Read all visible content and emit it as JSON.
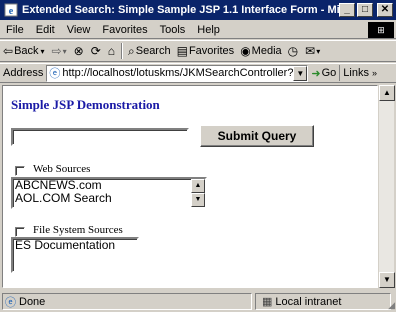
{
  "window": {
    "title": "Extended Search: Simple Sample JSP 1.1 Interface Form - Mi...",
    "min_glyph": "_",
    "max_glyph": "□",
    "close_glyph": "✕"
  },
  "menu": {
    "items": [
      "File",
      "Edit",
      "View",
      "Favorites",
      "Tools",
      "Help"
    ]
  },
  "toolbar": {
    "back_label": "Back",
    "search_label": "Search",
    "favorites_label": "Favorites",
    "media_label": "Media"
  },
  "address": {
    "label": "Address",
    "url": "http://localhost/lotuskms/JKMSearchController?desJ",
    "go_label": "Go",
    "links_label": "Links"
  },
  "page": {
    "heading": "Simple JSP Demonstration",
    "query_value": "",
    "submit_label": "Submit Query",
    "web_sources": {
      "label": "Web Sources",
      "checked": false,
      "options": [
        "ABCNEWS.com",
        "AOL.COM Search"
      ]
    },
    "file_sources": {
      "label": "File System Sources",
      "checked": false,
      "options": [
        "ES Documentation"
      ]
    }
  },
  "status": {
    "text": "Done",
    "zone": "Local intranet"
  },
  "colors": {
    "titlebar": "#0a246a",
    "heading": "#1a1aa6",
    "chrome": "#d4d0c8"
  }
}
